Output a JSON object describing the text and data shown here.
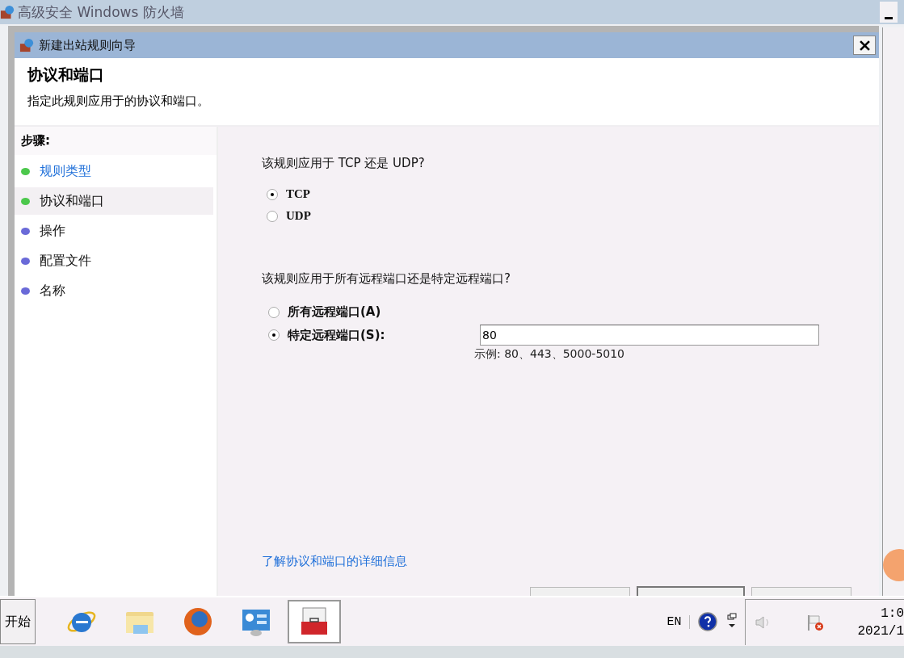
{
  "background_window": {
    "title": "高级安全 Windows 防火墙"
  },
  "dialog": {
    "title": "新建出站规则向导",
    "heading": "协议和端口",
    "subheading": "指定此规则应用于的协议和端口。"
  },
  "steps": {
    "title": "步骤:",
    "items": [
      {
        "label": "规则类型",
        "done": true,
        "selected": false
      },
      {
        "label": "协议和端口",
        "done": true,
        "selected": true
      },
      {
        "label": "操作",
        "done": false,
        "selected": false
      },
      {
        "label": "配置文件",
        "done": false,
        "selected": false
      },
      {
        "label": "名称",
        "done": false,
        "selected": false
      }
    ]
  },
  "protocol": {
    "question": "该规则应用于 TCP 还是 UDP?",
    "options": [
      {
        "label": "TCP",
        "selected": true
      },
      {
        "label": "UDP",
        "selected": false
      }
    ]
  },
  "ports": {
    "question": "该规则应用于所有远程端口还是特定远程端口?",
    "options": [
      {
        "label": "所有远程端口(A)",
        "selected": false
      },
      {
        "label": "特定远程端口(S):",
        "selected": true
      }
    ],
    "field": {
      "value": "80"
    },
    "example": "示例: 80、443、5000-5010"
  },
  "help_link": "了解协议和端口的详细信息",
  "taskbar": {
    "start": "开始",
    "apps": [
      {
        "kind": "ie",
        "selected": false
      },
      {
        "kind": "folder",
        "selected": false
      },
      {
        "kind": "firefox",
        "selected": false
      },
      {
        "kind": "panel",
        "selected": false
      },
      {
        "kind": "toolbox",
        "selected": true
      }
    ],
    "language": "EN",
    "clock_time": "1:0",
    "clock_date": "2021/1"
  }
}
